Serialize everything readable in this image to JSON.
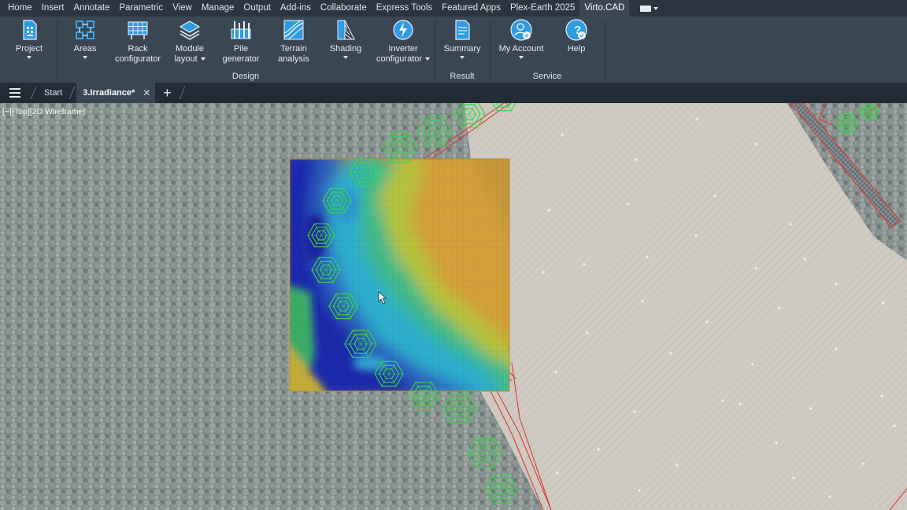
{
  "ribbon_tabs": [
    "Home",
    "Insert",
    "Annotate",
    "Parametric",
    "View",
    "Manage",
    "Output",
    "Add-ins",
    "Collaborate",
    "Express Tools",
    "Featured Apps",
    "Plex-Earth 2025",
    "Virto.CAD"
  ],
  "active_tab": "Virto.CAD",
  "ribbon": {
    "project": {
      "label": "Project"
    },
    "areas": {
      "label": "Areas"
    },
    "rack": {
      "line1": "Rack",
      "line2": "configurator"
    },
    "module": {
      "line1": "Module",
      "line2": "layout"
    },
    "pile": {
      "line1": "Pile",
      "line2": "generator"
    },
    "terrain": {
      "line1": "Terrain",
      "line2": "analysis"
    },
    "shading": {
      "label": "Shading"
    },
    "inverter": {
      "line1": "Inverter",
      "line2": "configurator"
    },
    "summary": {
      "label": "Summary"
    },
    "account": {
      "label": "My Account"
    },
    "help": {
      "label": "Help"
    },
    "groups": {
      "design": "Design",
      "result": "Result",
      "service": "Service"
    }
  },
  "file_tabs": {
    "start": "Start",
    "current": "3.Irradiance*"
  },
  "viewport": {
    "label": "[−][Top][2D Wireframe]"
  },
  "colors": {
    "accent": "#1f8fd6",
    "ribbon_bg": "#3b4653",
    "tab_bar": "#2b3540",
    "boundary": "#d9342b",
    "hex_marker": "#38d43a"
  },
  "icons": [
    "menu-icon",
    "close-icon",
    "plus-icon",
    "project-icon",
    "areas-icon",
    "rack-icon",
    "module-layout-icon",
    "pile-icon",
    "terrain-icon",
    "shading-icon",
    "inverter-icon",
    "summary-icon",
    "account-icon",
    "help-icon"
  ]
}
